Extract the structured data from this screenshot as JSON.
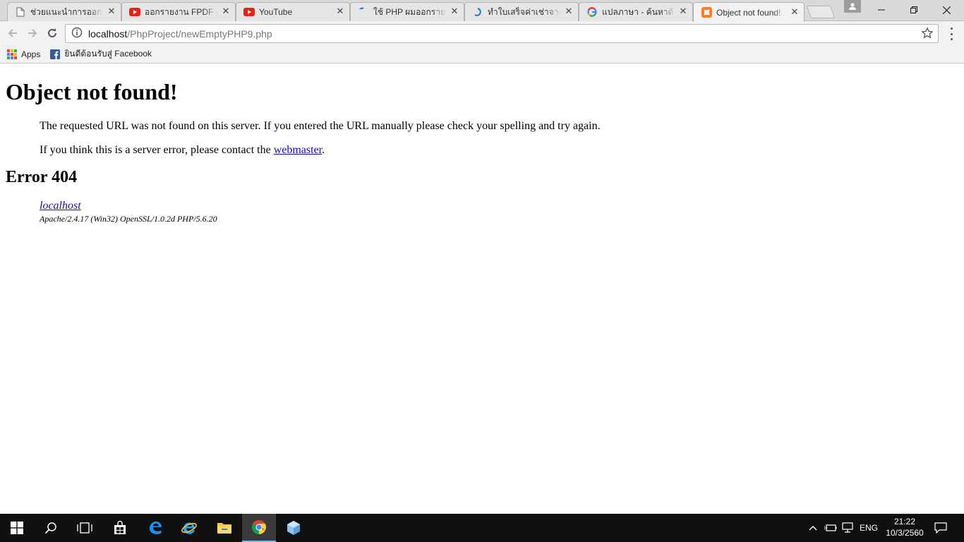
{
  "browser": {
    "tabs": [
      {
        "title": "ช่วยแนะนำการออกรายงาน",
        "icon": "document-icon"
      },
      {
        "title": "ออกรายงาน FPDF php",
        "icon": "youtube-icon"
      },
      {
        "title": "YouTube",
        "icon": "youtube-icon"
      },
      {
        "title": "ใช้ PHP ผมออกรายงาน",
        "icon": "loading-icon"
      },
      {
        "title": "ทำใบเสร็จค่าเช่าจาก PHP",
        "icon": "loading-icon"
      },
      {
        "title": "แปลภาษา - ค้นหาด้วย Google",
        "icon": "google-icon"
      },
      {
        "title": "Object not found!",
        "icon": "xampp-icon"
      }
    ],
    "active_tab_index": 6,
    "url_host": "localhost",
    "url_path": "/PhpProject/newEmptyPHP9.php",
    "bookmarks": [
      {
        "label": "Apps"
      },
      {
        "label": "ยินดีต้อนรับสู่ Facebook"
      }
    ]
  },
  "page": {
    "heading": "Object not found!",
    "para1": "The requested URL was not found on this server. If you entered the URL manually please check your spelling and try again.",
    "para2_prefix": "If you think this is a server error, please contact the ",
    "para2_link": "webmaster",
    "para2_suffix": ".",
    "error_heading": "Error 404",
    "address_link": "localhost",
    "server_signature": "Apache/2.4.17 (Win32) OpenSSL/1.0.2d PHP/5.6.20"
  },
  "taskbar": {
    "language": "ENG",
    "time": "21:22",
    "date": "10/3/2560"
  },
  "colors": {
    "link": "#1a0dab",
    "youtube": "#e62117",
    "xampp": "#fb7a24",
    "taskbar": "#101010",
    "active_underline": "#76b9ed"
  }
}
